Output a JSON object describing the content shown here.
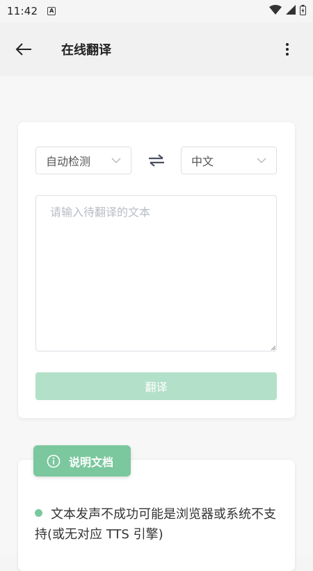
{
  "status_bar": {
    "time": "11:42",
    "a_icon_label": "A"
  },
  "app_bar": {
    "title": "在线翻译"
  },
  "translator": {
    "source_language": "自动检测",
    "target_language": "中文",
    "input_value": "",
    "input_placeholder": "请输入待翻译的文本",
    "translate_label": "翻译"
  },
  "docs": {
    "badge_label": "说明文档",
    "notes": [
      "文本发声不成功可能是浏览器或系统不支持(或无对应 TTS 引擎)"
    ]
  },
  "colors": {
    "accent": "#7bc79e",
    "button_disabled": "#b3e0c9",
    "background": "#f5f5f5"
  },
  "icons": {
    "back": "arrow-left-icon",
    "more": "more-vertical-icon",
    "swap": "swap-arrows-icon",
    "chevron": "chevron-down-icon",
    "info": "info-circle-icon",
    "wifi": "wifi-icon",
    "signal": "signal-icon",
    "battery": "battery-icon"
  }
}
